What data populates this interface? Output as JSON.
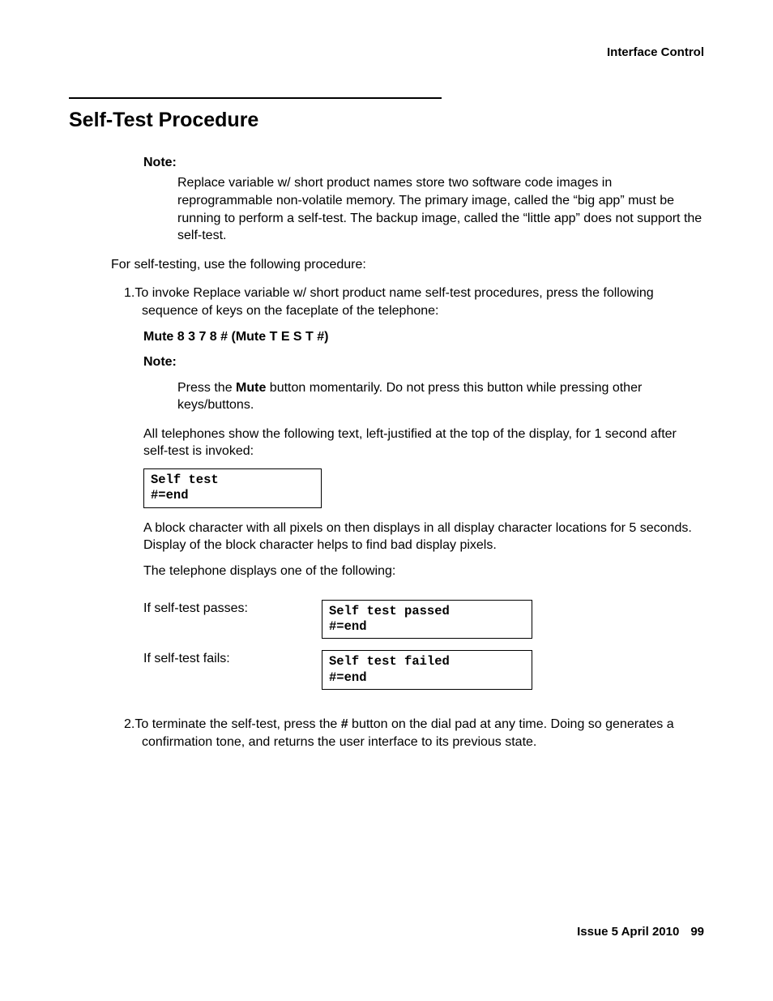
{
  "header": {
    "right": "Interface Control"
  },
  "title": "Self-Test Procedure",
  "note1": {
    "label": "Note:",
    "body": "Replace variable w/ short product names store two software code images in reprogrammable non-volatile memory. The primary image, called the “big app” must be running to perform a self-test. The backup image, called the “little app” does not support the self-test."
  },
  "intro": "For self-testing, use the following procedure:",
  "step1": {
    "num": "1.",
    "text": "To invoke Replace variable w/ short product name self-test procedures, press the following sequence of keys on the faceplate of the telephone:",
    "keys": "Mute 8 3 7 8 # (Mute T E S T #)",
    "note_label": "Note:",
    "note_body_a": "Press the ",
    "note_body_bold": "Mute",
    "note_body_b": " button momentarily. Do not press this button while pressing other keys/buttons.",
    "after_note": "All telephones show the following text, left-justified at the top of the display, for 1 second after self-test is invoked:",
    "code1": "Self test\n#=end",
    "block_char": "A block character with all pixels on then displays in all display character locations for 5 seconds. Display of the block character helps to find bad display pixels.",
    "displays_one": "The telephone displays one of the following:",
    "pass_label": "If self-test passes:",
    "pass_code": "Self test passed\n#=end",
    "fail_label": "If self-test fails:",
    "fail_code": "Self test failed\n#=end"
  },
  "step2": {
    "num": "2.",
    "text_a": "To terminate the self-test, press the ",
    "bold": "#",
    "text_b": " button on the dial pad at any time. Doing so generates a confirmation tone, and returns the user interface to its previous state."
  },
  "footer": {
    "issue": "Issue 5   April 2010",
    "page": "99"
  }
}
